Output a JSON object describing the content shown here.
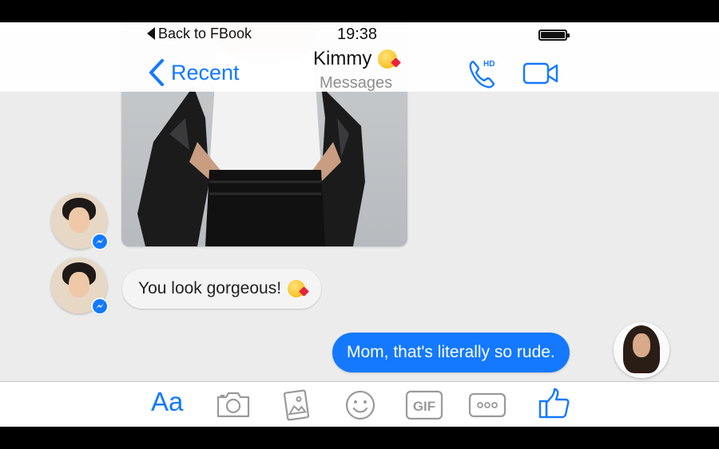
{
  "status_bar": {
    "back_label": "Back to FBook",
    "time": "19:38"
  },
  "header": {
    "back_label": "Recent",
    "contact_name": "Kimmy",
    "subtitle": "Messages",
    "call_badge": "HD"
  },
  "messages": [
    {
      "direction": "incoming",
      "type": "image"
    },
    {
      "direction": "incoming",
      "type": "text",
      "text": "You look gorgeous!"
    },
    {
      "direction": "outgoing",
      "type": "text",
      "text": "Mom, that's literally so rude."
    }
  ],
  "composer": {
    "text_button_label": "Aa",
    "gif_label": "GIF",
    "more_label": "○○○"
  },
  "colors": {
    "accent": "#1479ff",
    "outgoing_bubble": "#1479ff",
    "incoming_bubble": "#f4f4f4",
    "background": "#ececec"
  }
}
